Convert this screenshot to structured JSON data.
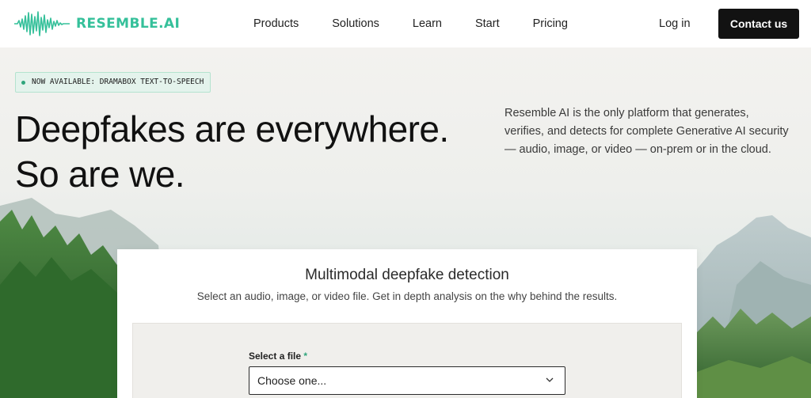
{
  "brand": {
    "name": "RESEMBLE.AI",
    "color": "#35c09a",
    "logo_icon": "waveform-icon"
  },
  "nav": {
    "items": [
      {
        "label": "Products"
      },
      {
        "label": "Solutions"
      },
      {
        "label": "Learn"
      },
      {
        "label": "Start"
      },
      {
        "label": "Pricing"
      }
    ],
    "login_label": "Log in",
    "contact_label": "Contact us"
  },
  "hero": {
    "badge": "NOW AVAILABLE: DRAMABOX TEXT-TO-SPEECH",
    "headline": "Deepfakes are everywhere. So are we.",
    "description": "Resemble AI is the only platform that generates, verifies, and detects for complete Generative AI security — audio, image, or video — on-prem or in the cloud."
  },
  "detector": {
    "title": "Multimodal deepfake detection",
    "subtitle": "Select an audio, image, or video file. Get in depth analysis on the why behind the results.",
    "field_label": "Select a file",
    "required_mark": "*",
    "select_value": "Choose one..."
  },
  "colors": {
    "accent": "#2fa57c",
    "button_dark": "#121212"
  }
}
